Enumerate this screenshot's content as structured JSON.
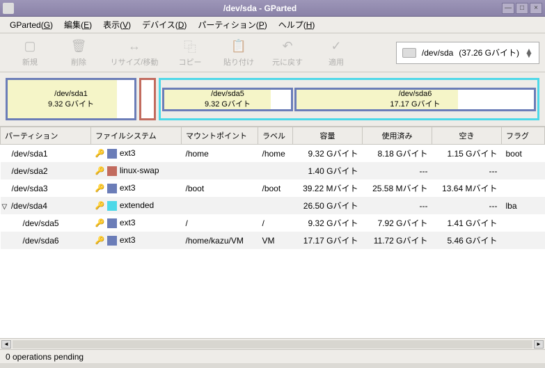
{
  "window": {
    "title": "/dev/sda - GParted"
  },
  "menus": {
    "gparted": {
      "label": "GParted",
      "key": "G"
    },
    "edit": {
      "label": "編集",
      "key": "E"
    },
    "view": {
      "label": "表示",
      "key": "V"
    },
    "device": {
      "label": "デバイス",
      "key": "D"
    },
    "partition": {
      "label": "パーティション",
      "key": "P"
    },
    "help": {
      "label": "ヘルプ",
      "key": "H"
    }
  },
  "toolbar": {
    "new": "新規",
    "delete": "削除",
    "resize": "リサイズ/移動",
    "copy": "コピー",
    "paste": "貼り付け",
    "undo": "元に戻す",
    "apply": "適用"
  },
  "device": {
    "name": "/dev/sda",
    "size": "(37.26 Gバイト)"
  },
  "graphic": {
    "sda1": {
      "name": "/dev/sda1",
      "size": "9.32 Gバイト"
    },
    "sda5": {
      "name": "/dev/sda5",
      "size": "9.32 Gバイト"
    },
    "sda6": {
      "name": "/dev/sda6",
      "size": "17.17 Gバイト"
    }
  },
  "headers": {
    "partition": "パーティション",
    "filesystem": "ファイルシステム",
    "mountpoint": "マウントポイント",
    "label": "ラベル",
    "size": "容量",
    "used": "使用済み",
    "free": "空き",
    "flags": "フラグ"
  },
  "rows": [
    {
      "partition": "/dev/sda1",
      "lock": true,
      "fscolor": "#6b7db8",
      "fs": "ext3",
      "mount": "/home",
      "label": "/home",
      "size": "9.32 Gバイト",
      "used": "8.18 Gバイト",
      "free": "1.15 Gバイト",
      "flags": "boot",
      "indent": 1
    },
    {
      "partition": "/dev/sda2",
      "lock": true,
      "fscolor": "#c26b5e",
      "fs": "linux-swap",
      "mount": "",
      "label": "",
      "size": "1.40 Gバイト",
      "used": "---",
      "free": "---",
      "flags": "",
      "indent": 1
    },
    {
      "partition": "/dev/sda3",
      "lock": true,
      "fscolor": "#6b7db8",
      "fs": "ext3",
      "mount": "/boot",
      "label": "/boot",
      "size": "39.22 Mバイト",
      "used": "25.58 Mバイト",
      "free": "13.64 Mバイト",
      "flags": "",
      "indent": 1
    },
    {
      "partition": "/dev/sda4",
      "lock": true,
      "fscolor": "#4dd8e8",
      "fs": "extended",
      "mount": "",
      "label": "",
      "size": "26.50 Gバイト",
      "used": "---",
      "free": "---",
      "flags": "lba",
      "indent": 1,
      "expand": true
    },
    {
      "partition": "/dev/sda5",
      "lock": true,
      "fscolor": "#6b7db8",
      "fs": "ext3",
      "mount": "/",
      "label": "/",
      "size": "9.32 Gバイト",
      "used": "7.92 Gバイト",
      "free": "1.41 Gバイト",
      "flags": "",
      "indent": 2
    },
    {
      "partition": "/dev/sda6",
      "lock": true,
      "fscolor": "#6b7db8",
      "fs": "ext3",
      "mount": "/home/kazu/VM",
      "label": "VM",
      "size": "17.17 Gバイト",
      "used": "11.72 Gバイト",
      "free": "5.46 Gバイト",
      "flags": "",
      "indent": 2
    }
  ],
  "status": "0 operations pending"
}
